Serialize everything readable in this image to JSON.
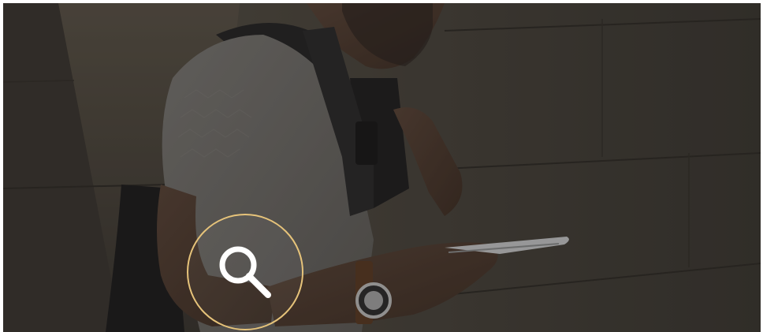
{
  "hero": {
    "image": "man-with-backpack-looking-at-phone-against-wall",
    "overlay": "dark-tint"
  },
  "search": {
    "icon": "magnifying-glass-icon",
    "ring_color": "#e6c37a",
    "icon_color": "#ffffff"
  }
}
